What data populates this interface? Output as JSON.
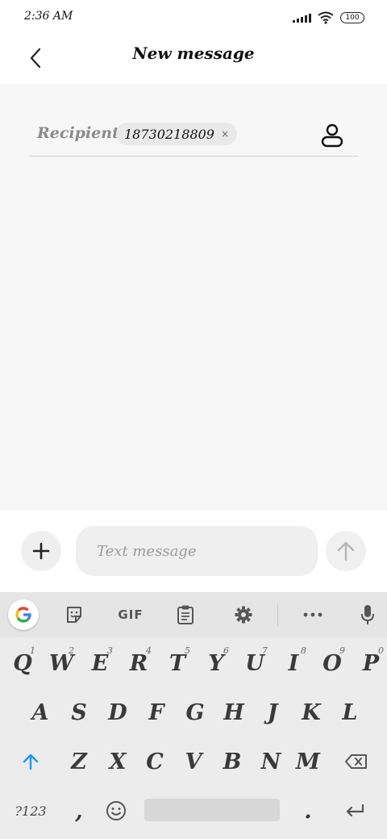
{
  "status_bar": {
    "time": "2:36 AM",
    "battery": "100",
    "icons": [
      "signal-icon",
      "wifi-icon",
      "battery-icon"
    ]
  },
  "header": {
    "title": "New message",
    "back_icon": "back-arrow-icon"
  },
  "recipient": {
    "label": "Recipient:",
    "chip_value": "18730218809",
    "chip_remove": "×",
    "contact_icon": "person-icon"
  },
  "compose": {
    "placeholder": "Text message",
    "attach_icon": "plus-icon",
    "send_icon": "arrow-up-icon"
  },
  "keyboard": {
    "toolbar": {
      "google_icon": "google-icon",
      "sticker_icon": "sticker-icon",
      "gif_label": "GIF",
      "clipboard_icon": "clipboard-icon",
      "settings_icon": "gear-icon",
      "more_icon": "more-icon",
      "mic_icon": "mic-icon"
    },
    "row1": [
      {
        "key": "Q",
        "hint": "1"
      },
      {
        "key": "W",
        "hint": "2"
      },
      {
        "key": "E",
        "hint": "3"
      },
      {
        "key": "R",
        "hint": "4"
      },
      {
        "key": "T",
        "hint": "5"
      },
      {
        "key": "Y",
        "hint": "6"
      },
      {
        "key": "U",
        "hint": "7"
      },
      {
        "key": "I",
        "hint": "8"
      },
      {
        "key": "O",
        "hint": "9"
      },
      {
        "key": "P",
        "hint": "0"
      }
    ],
    "row2": [
      "A",
      "S",
      "D",
      "F",
      "G",
      "H",
      "J",
      "K",
      "L"
    ],
    "row3": [
      "Z",
      "X",
      "C",
      "V",
      "B",
      "N",
      "M"
    ],
    "row4": {
      "symbols": "?123",
      "comma": ",",
      "period": ".",
      "shift_icon": "shift-arrow-icon",
      "backspace_icon": "backspace-icon",
      "emoji_icon": "emoji-icon",
      "enter_icon": "enter-icon"
    }
  },
  "colors": {
    "shift_accent": "#2196f3",
    "google_blue": "#4285f4",
    "google_red": "#ea4335",
    "google_yellow": "#fbbc05",
    "google_green": "#34a853"
  }
}
